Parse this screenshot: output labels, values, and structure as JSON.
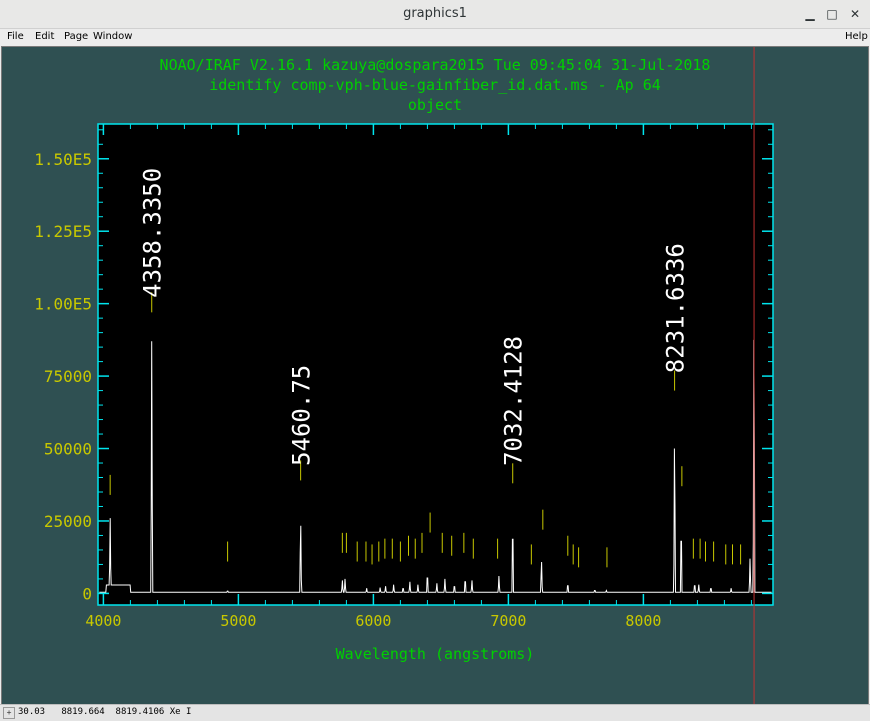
{
  "window": {
    "title": "graphics1",
    "minimize_glyph": "▁",
    "maximize_glyph": "□",
    "close_glyph": "✕"
  },
  "menu": {
    "file": "File",
    "edit": "Edit",
    "page": "Page",
    "window": "Window",
    "help": "Help"
  },
  "plot": {
    "header_line1": "NOAO/IRAF V2.16.1 kazuya@dospara2015 Tue 09:45:04 31-Jul-2018",
    "header_line2": "identify comp-vph-blue-gainfiber_id.dat.ms - Ap 64",
    "header_line3": "object",
    "colors": {
      "background": "#000000",
      "frame": "#00e5ee",
      "header_text": "#00d000",
      "axis_labels": "#c8c800",
      "spectrum": "#ffffff",
      "feature_marks": "#c8c800",
      "cursor": "#c03030"
    }
  },
  "status": {
    "text": "30.03   8819.664  8819.4106 Xe I"
  },
  "chart_data": {
    "type": "line",
    "xlabel": "Wavelength (angstroms)",
    "ylabel": "",
    "xlim": [
      3960,
      8960
    ],
    "ylim": [
      -4000,
      162000
    ],
    "x_ticks": [
      4000,
      5000,
      6000,
      7000,
      8000
    ],
    "x_tick_labels": [
      "4000",
      "5000",
      "6000",
      "7000",
      "8000"
    ],
    "y_ticks": [
      0,
      25000,
      50000,
      75000,
      100000,
      125000,
      150000
    ],
    "y_tick_labels": [
      "0",
      "25000",
      "50000",
      "75000",
      "1.00E5",
      "1.25E5",
      "1.50E5"
    ],
    "grid": false,
    "peaks": [
      {
        "x": 4050,
        "y": 26000
      },
      {
        "x": 4358,
        "y": 87000
      },
      {
        "x": 4920,
        "y": 1200
      },
      {
        "x": 5461,
        "y": 28000
      },
      {
        "x": 5770,
        "y": 4500
      },
      {
        "x": 5790,
        "y": 5000
      },
      {
        "x": 5950,
        "y": 1800
      },
      {
        "x": 6050,
        "y": 2000
      },
      {
        "x": 6090,
        "y": 2500
      },
      {
        "x": 6150,
        "y": 3000
      },
      {
        "x": 6220,
        "y": 2500
      },
      {
        "x": 6270,
        "y": 4000
      },
      {
        "x": 6330,
        "y": 3000
      },
      {
        "x": 6400,
        "y": 8000
      },
      {
        "x": 6470,
        "y": 3500
      },
      {
        "x": 6530,
        "y": 5000
      },
      {
        "x": 6600,
        "y": 3500
      },
      {
        "x": 6680,
        "y": 6000
      },
      {
        "x": 6730,
        "y": 4500
      },
      {
        "x": 6930,
        "y": 6000
      },
      {
        "x": 7032,
        "y": 28000
      },
      {
        "x": 7245,
        "y": 13000
      },
      {
        "x": 7440,
        "y": 4000
      },
      {
        "x": 7640,
        "y": 1500
      },
      {
        "x": 7725,
        "y": 1200
      },
      {
        "x": 8231,
        "y": 60000
      },
      {
        "x": 8280,
        "y": 27000
      },
      {
        "x": 8380,
        "y": 4000
      },
      {
        "x": 8410,
        "y": 3000
      },
      {
        "x": 8500,
        "y": 2500
      },
      {
        "x": 8650,
        "y": 1800
      },
      {
        "x": 8790,
        "y": 12000
      },
      {
        "x": 8819,
        "y": 105000
      }
    ],
    "marks": [
      {
        "x": 4050,
        "y": 34000
      },
      {
        "x": 4358,
        "y": 97000
      },
      {
        "x": 4920,
        "y": 11000
      },
      {
        "x": 5461,
        "y": 39000
      },
      {
        "x": 5770,
        "y": 14000
      },
      {
        "x": 5800,
        "y": 14000
      },
      {
        "x": 5880,
        "y": 11000
      },
      {
        "x": 5945,
        "y": 11000
      },
      {
        "x": 5990,
        "y": 10000
      },
      {
        "x": 6040,
        "y": 11000
      },
      {
        "x": 6085,
        "y": 12000
      },
      {
        "x": 6140,
        "y": 12000
      },
      {
        "x": 6200,
        "y": 11000
      },
      {
        "x": 6260,
        "y": 13000
      },
      {
        "x": 6310,
        "y": 12000
      },
      {
        "x": 6360,
        "y": 14000
      },
      {
        "x": 6420,
        "y": 21000
      },
      {
        "x": 6510,
        "y": 14000
      },
      {
        "x": 6580,
        "y": 13000
      },
      {
        "x": 6670,
        "y": 14000
      },
      {
        "x": 6740,
        "y": 12000
      },
      {
        "x": 6920,
        "y": 12000
      },
      {
        "x": 7032,
        "y": 38000
      },
      {
        "x": 7170,
        "y": 10000
      },
      {
        "x": 7255,
        "y": 22000
      },
      {
        "x": 7440,
        "y": 13000
      },
      {
        "x": 7480,
        "y": 10000
      },
      {
        "x": 7520,
        "y": 9000
      },
      {
        "x": 7730,
        "y": 9000
      },
      {
        "x": 8231,
        "y": 70000
      },
      {
        "x": 8285,
        "y": 37000
      },
      {
        "x": 8370,
        "y": 12000
      },
      {
        "x": 8420,
        "y": 12000
      },
      {
        "x": 8460,
        "y": 11000
      },
      {
        "x": 8520,
        "y": 11000
      },
      {
        "x": 8610,
        "y": 10000
      },
      {
        "x": 8660,
        "y": 10000
      },
      {
        "x": 8720,
        "y": 10000
      }
    ],
    "annotations": [
      {
        "x": 4358,
        "text": "4358.3350",
        "y": 102000
      },
      {
        "x": 5460.75,
        "text": "5460.75",
        "y": 44000
      },
      {
        "x": 7032,
        "text": "7032.4128",
        "y": 44000
      },
      {
        "x": 8231,
        "text": "8231.6336",
        "y": 76000
      }
    ],
    "cursor_x": 8819.664
  }
}
